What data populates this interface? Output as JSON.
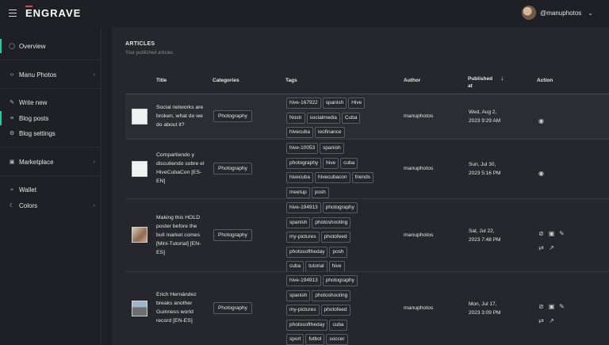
{
  "app": {
    "logo_pre": "E",
    "logo_rest": "NGRAVE"
  },
  "user": {
    "handle": "@manuphotos"
  },
  "sidebar": {
    "items": [
      {
        "label": "Overview"
      },
      {
        "label": "Manu Photos"
      },
      {
        "label": "Write new"
      },
      {
        "label": "Blog posts"
      },
      {
        "label": "Blog settings"
      },
      {
        "label": "Marketplace"
      },
      {
        "label": "Wallet"
      },
      {
        "label": "Colors"
      }
    ]
  },
  "main": {
    "title": "ARTICLES",
    "subtitle": "Your published articles",
    "headers": {
      "title": "Title",
      "categories": "Categories",
      "tags": "Tags",
      "author": "Author",
      "published_1": "Published",
      "published_2": "at",
      "action": "Action"
    },
    "rows": [
      {
        "title": "Social networks are broken, what do we do about it?",
        "category": "Photography",
        "tags": [
          "hive-167922",
          "spanish",
          "Hive",
          "Nostr",
          "socialmedia",
          "Cuba",
          "hivecuba",
          "leofinance"
        ],
        "author": "manuphotos",
        "date_1": "Wed, Aug 2,",
        "date_2": "2023 9:29 AM"
      },
      {
        "title": "Compartiendo y discutiendo sobre el HiveCubaCon [ES-EN]",
        "category": "Photography",
        "tags": [
          "hive-10053",
          "spanish",
          "photography",
          "hive",
          "cuba",
          "hivecuba",
          "hivecubacon",
          "friends",
          "meetup",
          "posh"
        ],
        "author": "manuphotos",
        "date_1": "Sun, Jul 30,",
        "date_2": "2023 5:16 PM"
      },
      {
        "title": "Making this HOLD poster before the bull market comes [Mini-Tutorial] [EN-ES]",
        "category": "Photography",
        "tags": [
          "hive-194913",
          "photography",
          "spanish",
          "photoshooting",
          "my-pictures",
          "photofeed",
          "photosoftheday",
          "posh",
          "cuba",
          "tutorial",
          "hive"
        ],
        "author": "manuphotos",
        "date_1": "Sat, Jul 22,",
        "date_2": "2023 7:48 PM"
      },
      {
        "title": "Erich Hernández breaks another Guinness world record [EN-ES]",
        "category": "Photography",
        "tags": [
          "hive-194913",
          "photography",
          "spanish",
          "photoshooting",
          "my-pictures",
          "photofeed",
          "photosoftheday",
          "cuba",
          "sport",
          "futbol",
          "soccer"
        ],
        "author": "manuphotos",
        "date_1": "Mon, Jul 17,",
        "date_2": "2023 3:09 PM"
      }
    ]
  },
  "colors": {
    "accent": "#26c8a0",
    "logo_bar": "#d94c4c"
  },
  "icons": {
    "view": "eye-icon",
    "hide": "eye-off-icon",
    "delete": "trash-icon",
    "edit": "pencil-icon",
    "shuffle": "shuffle-icon",
    "open": "external-link-icon"
  }
}
